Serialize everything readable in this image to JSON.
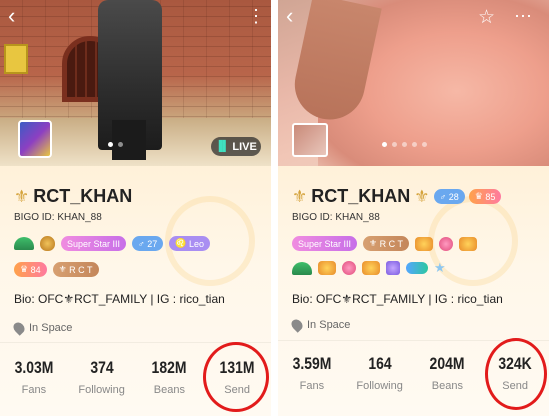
{
  "left": {
    "name": "RCT_KHAN",
    "bigo_id": "BIGO ID: KHAN_88",
    "badges_row1": [
      "Super Star III",
      "27",
      "Leo"
    ],
    "badges_row2": [
      "84",
      "R C T"
    ],
    "bio": "Bio: OFC⚜RCT_FAMILY | IG : rico_tian",
    "location": "In Space",
    "live_label": "LIVE",
    "stats": [
      {
        "value": "3.03M",
        "label": "Fans"
      },
      {
        "value": "374",
        "label": "Following"
      },
      {
        "value": "182M",
        "label": "Beans"
      },
      {
        "value": "131M",
        "label": "Send"
      }
    ]
  },
  "right": {
    "name": "RCT_KHAN",
    "bigo_id": "BIGO ID: KHAN_88",
    "name_badges": [
      "28",
      "85"
    ],
    "badges_row1": [
      "Super Star III",
      "R C T"
    ],
    "bio": "Bio: OFC⚜RCT_FAMILY | IG : rico_tian",
    "location": "In Space",
    "stats": [
      {
        "value": "3.59M",
        "label": "Fans"
      },
      {
        "value": "164",
        "label": "Following"
      },
      {
        "value": "204M",
        "label": "Beans"
      },
      {
        "value": "324K",
        "label": "Send"
      }
    ]
  },
  "icons": {
    "back": "chevron-left-icon",
    "more": "more-dots-icon",
    "star": "star-outline-icon",
    "pin": "location-pin-icon"
  },
  "colors": {
    "highlight_circle": "#e21b1b",
    "name_badge_blue": "#6aa8ef",
    "name_badge_orange": "#ffa24a"
  }
}
